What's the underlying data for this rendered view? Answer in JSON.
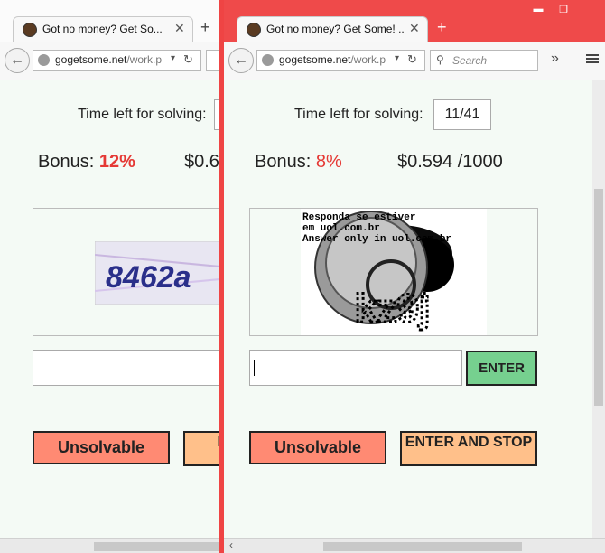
{
  "left_window": {
    "tab_title": "Got no money? Get So...",
    "tab_close": "✕",
    "new_tab": "+",
    "url_domain": "gogetsome.net",
    "url_path": "/work.p",
    "back_icon": "←",
    "reload_icon": "↻",
    "dropdown_icon": "▾",
    "timer_label": "Time left for solving:",
    "bonus_label": "Bonus:",
    "bonus_value": "12%",
    "rate": "$0.6",
    "captcha_text": "8462a",
    "unsolvable_label": "Unsolvable",
    "stop_label_partial": "EI"
  },
  "right_window": {
    "tab_title": "Got no money? Get Some! ...",
    "tab_close": "✕",
    "new_tab": "+",
    "url_domain": "gogetsome.net",
    "url_path": "/work.p",
    "back_icon": "←",
    "reload_icon": "↻",
    "dropdown_icon": "▾",
    "search_placeholder": "Search",
    "overflow_icon": "»",
    "minimize_icon": "▬",
    "maximize_icon": "❐",
    "timer_label": "Time left for solving:",
    "timer_value": "11/41",
    "bonus_label": "Bonus:",
    "bonus_value": "8%",
    "rate": "$0.594 /1000",
    "captcha_line1": "Responda se estiver",
    "captcha_line2": "em uol.com.br",
    "captcha_line3": "Answer only in uol.com.br",
    "captcha_glyphs": "kz9j",
    "enter_label": "ENTER",
    "unsolvable_label": "Unsolvable",
    "enter_and_stop_label": "ENTER AND STOP"
  },
  "scroll_left_icon": "‹",
  "colors": {
    "divider": "#ef4444",
    "bonus_red": "#e53935",
    "enter_green": "#76d08f",
    "unsolvable_salmon": "#ff8a73",
    "stop_orange": "#ffc08a",
    "page_bg": "#f4faf5"
  }
}
